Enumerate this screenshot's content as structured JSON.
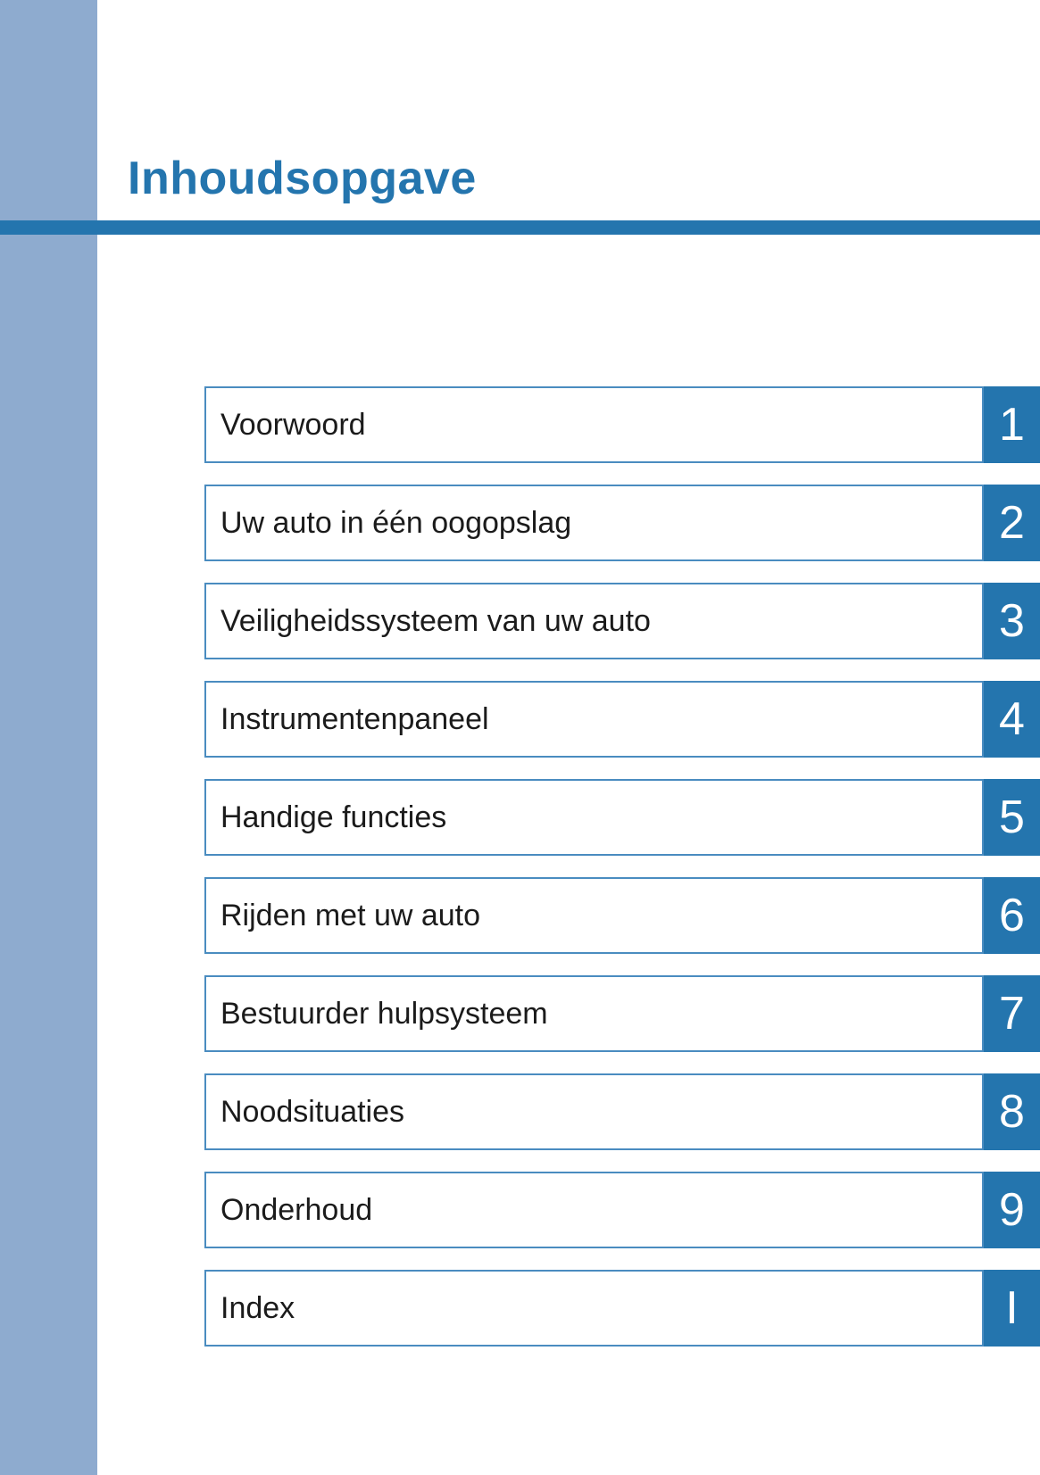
{
  "page": {
    "title": "Inhoudsopgave"
  },
  "colors": {
    "accent": "#2475ae",
    "side_stripe": "#8eabcf",
    "border": "#4a8cc0",
    "text": "#1b1b1b"
  },
  "toc": {
    "items": [
      {
        "label": "Voorwoord",
        "number": "1"
      },
      {
        "label": "Uw auto in één oogopslag",
        "number": "2"
      },
      {
        "label": "Veiligheidssysteem van uw auto",
        "number": "3"
      },
      {
        "label": "Instrumentenpaneel",
        "number": "4"
      },
      {
        "label": "Handige functies",
        "number": "5"
      },
      {
        "label": "Rijden met uw auto",
        "number": "6"
      },
      {
        "label": "Bestuurder hulpsysteem",
        "number": "7"
      },
      {
        "label": "Noodsituaties",
        "number": "8"
      },
      {
        "label": "Onderhoud",
        "number": "9"
      },
      {
        "label": "Index",
        "number": "I"
      }
    ]
  }
}
